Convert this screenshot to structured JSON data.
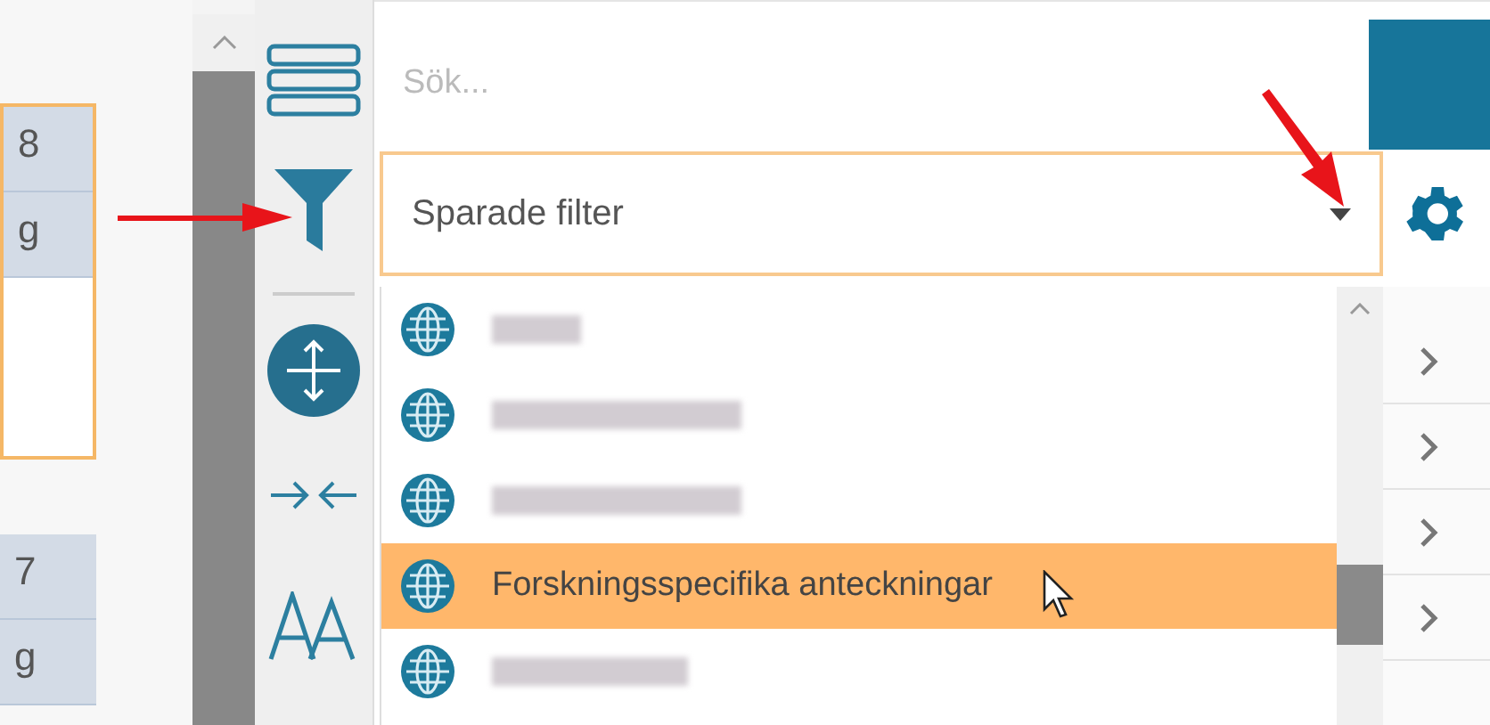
{
  "left_table": {
    "groups": [
      {
        "selected": true,
        "cells": [
          "8",
          "g"
        ]
      },
      {
        "selected": false,
        "cells": [
          "7",
          "g"
        ]
      }
    ]
  },
  "search": {
    "placeholder": "Sök..."
  },
  "saved_filter": {
    "value": "Sparade filter"
  },
  "filter_list": {
    "items": [
      {
        "kind": "redacted",
        "selected": false
      },
      {
        "kind": "redacted",
        "selected": false
      },
      {
        "kind": "redacted",
        "selected": false
      },
      {
        "kind": "text",
        "label": "Forskningsspecifika anteckningar",
        "selected": true
      },
      {
        "kind": "redacted",
        "selected": false
      }
    ]
  },
  "side_rows": [
    {
      "expanded": false
    },
    {
      "expanded": false
    },
    {
      "expanded": false
    },
    {
      "expanded": false
    }
  ]
}
